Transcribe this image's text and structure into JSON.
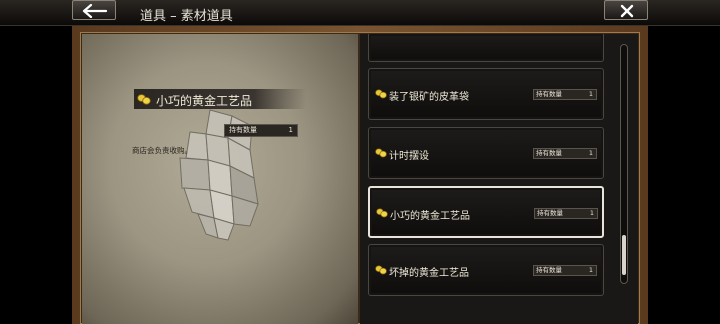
{
  "header": {
    "title": "道具 – 素材道具",
    "back_icon": "back-arrow-icon",
    "close_icon": "close-icon"
  },
  "detail": {
    "name": "小巧的黄金工艺品",
    "qty_label": "持有数量",
    "qty_value": "1",
    "description": "商店会负责收购。",
    "icon": "coin-icon"
  },
  "list": {
    "items": [
      {
        "name": "",
        "qty_label": "",
        "qty_value": ""
      },
      {
        "name": "装了银矿的皮革袋",
        "qty_label": "持有数量",
        "qty_value": "1"
      },
      {
        "name": "计时摆设",
        "qty_label": "持有数量",
        "qty_value": "1"
      },
      {
        "name": "小巧的黄金工艺品",
        "qty_label": "持有数量",
        "qty_value": "1",
        "selected": true
      },
      {
        "name": "坏掉的黄金工艺品",
        "qty_label": "持有数量",
        "qty_value": "1"
      }
    ]
  },
  "colors": {
    "accent_gold": "#e8c838",
    "frame_wood": "#7a5430",
    "parchment": "#a39c88"
  }
}
